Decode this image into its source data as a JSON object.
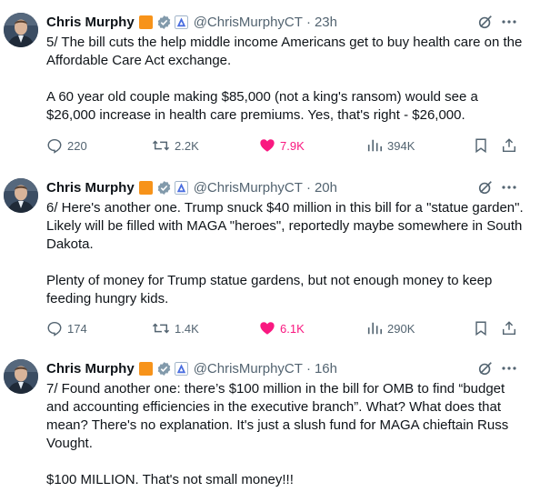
{
  "author": {
    "name": "Chris Murphy",
    "handle": "@ChrisMurphyCT",
    "separator": "·"
  },
  "colors": {
    "like_active": "#f91880",
    "badge_orange": "#f7931a",
    "verified": "#829aab",
    "muted_text": "#536471"
  },
  "icons": [
    "grok-icon",
    "more-icon",
    "reply-icon",
    "retweet-icon",
    "heart-icon",
    "views-icon",
    "bookmark-icon",
    "share-icon",
    "verified-icon",
    "government-affiliation-icon"
  ],
  "tweets": [
    {
      "time": "23h",
      "paragraphs": [
        "5/ The bill cuts the help middle income Americans get to buy health care on the Affordable Care Act exchange.",
        "A 60 year old couple making $85,000 (not a king's ransom) would see a $26,000 increase in health care premiums. Yes, that's right - $26,000."
      ],
      "stats": {
        "replies": "220",
        "reposts": "2.2K",
        "likes": "7.9K",
        "views": "394K"
      },
      "liked": true
    },
    {
      "time": "20h",
      "paragraphs": [
        "6/ Here's another one. Trump snuck $40 million in this bill for a \"statue garden\". Likely will be filled with MAGA \"heroes\", reportedly maybe somewhere in South Dakota.",
        "Plenty of money for Trump statue gardens, but not enough money to keep feeding hungry kids."
      ],
      "stats": {
        "replies": "174",
        "reposts": "1.4K",
        "likes": "6.1K",
        "views": "290K"
      },
      "liked": true
    },
    {
      "time": "16h",
      "paragraphs": [
        "7/ Found another one: there’s $100 million in the bill for OMB to find “budget and accounting efficiencies in the executive branch”. What? What does that mean? There's no explanation. It's just a slush fund for MAGA chieftain Russ Vought.",
        "$100 MILLION. That's not small money!!!"
      ]
    }
  ]
}
